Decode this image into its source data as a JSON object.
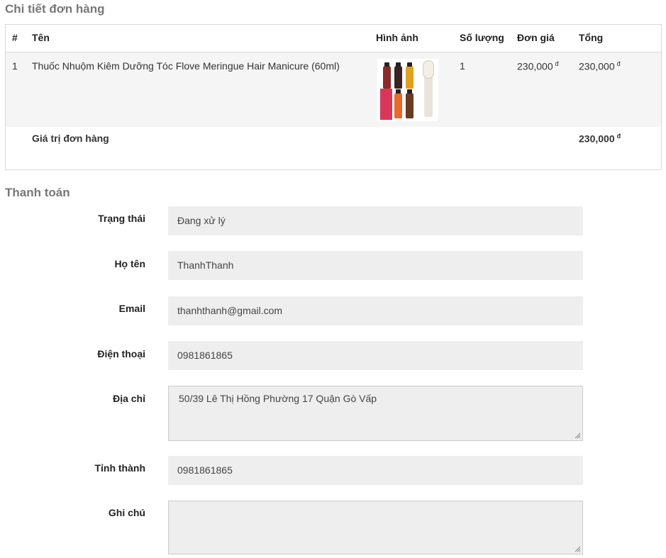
{
  "order_section": {
    "title": "Chi tiết đơn hàng",
    "columns": [
      "#",
      "Tên",
      "Hình ảnh",
      "Số lượng",
      "Đơn giá",
      "Tổng"
    ],
    "items": [
      {
        "index": "1",
        "name": "Thuốc Nhuộm Kiêm Dưỡng Tóc Flove Meringue Hair Manicure (60ml)",
        "quantity": "1",
        "unit_price": "230,000",
        "total": "230,000"
      }
    ],
    "currency_symbol": "đ",
    "order_total_label": "Giá trị đơn hàng",
    "order_total_value": "230,000"
  },
  "payment_section": {
    "title": "Thanh toán",
    "status": {
      "label": "Trạng thái",
      "value": "Đang xử lý"
    },
    "full_name": {
      "label": "Họ tên",
      "value": "ThanhThanh"
    },
    "email": {
      "label": "Email",
      "value": "thanhthanh@gmail.com"
    },
    "phone": {
      "label": "Điện thoại",
      "value": "0981861865"
    },
    "address": {
      "label": "Địa chỉ",
      "value": "50/39 Lê Thị Hồng Phường 17 Quận Gò Vấp"
    },
    "province": {
      "label": "Tỉnh thành",
      "value": "0981861865"
    },
    "note": {
      "label": "Ghi chú",
      "value": ""
    }
  }
}
